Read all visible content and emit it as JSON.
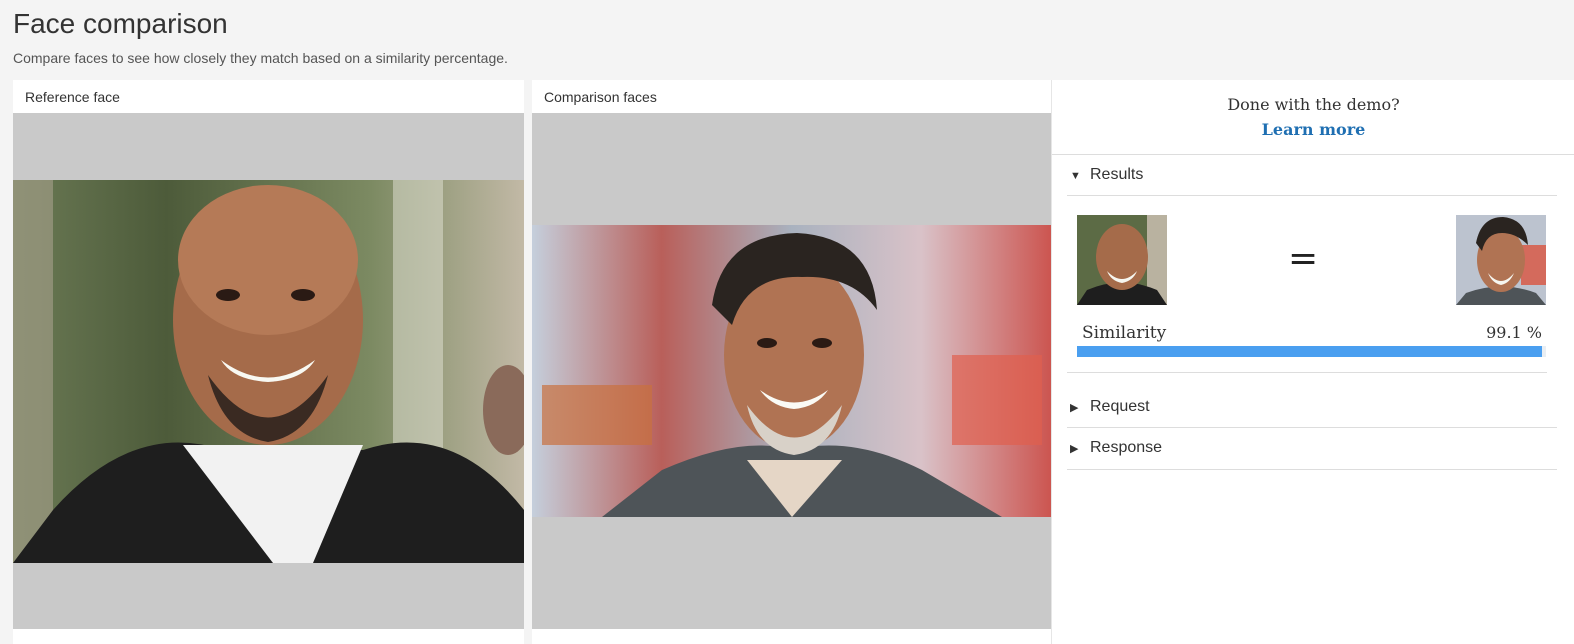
{
  "header": {
    "title": "Face comparison",
    "subtitle": "Compare faces to see how closely they match based on a similarity percentage."
  },
  "reference": {
    "label": "Reference face"
  },
  "comparison": {
    "label": "Comparison faces"
  },
  "sidebar": {
    "done_text": "Done with the demo?",
    "learn_more": "Learn more",
    "sections": {
      "results": "Results",
      "request": "Request",
      "response": "Response"
    },
    "result": {
      "equals_symbol": "=",
      "similarity_label": "Similarity",
      "similarity_value": "99.1 %",
      "similarity_fraction": 0.991
    }
  },
  "colors": {
    "accent_link": "#1f6fb2",
    "bar_fill": "#4a9ff0",
    "canvas_bg": "#c9c9c9"
  }
}
